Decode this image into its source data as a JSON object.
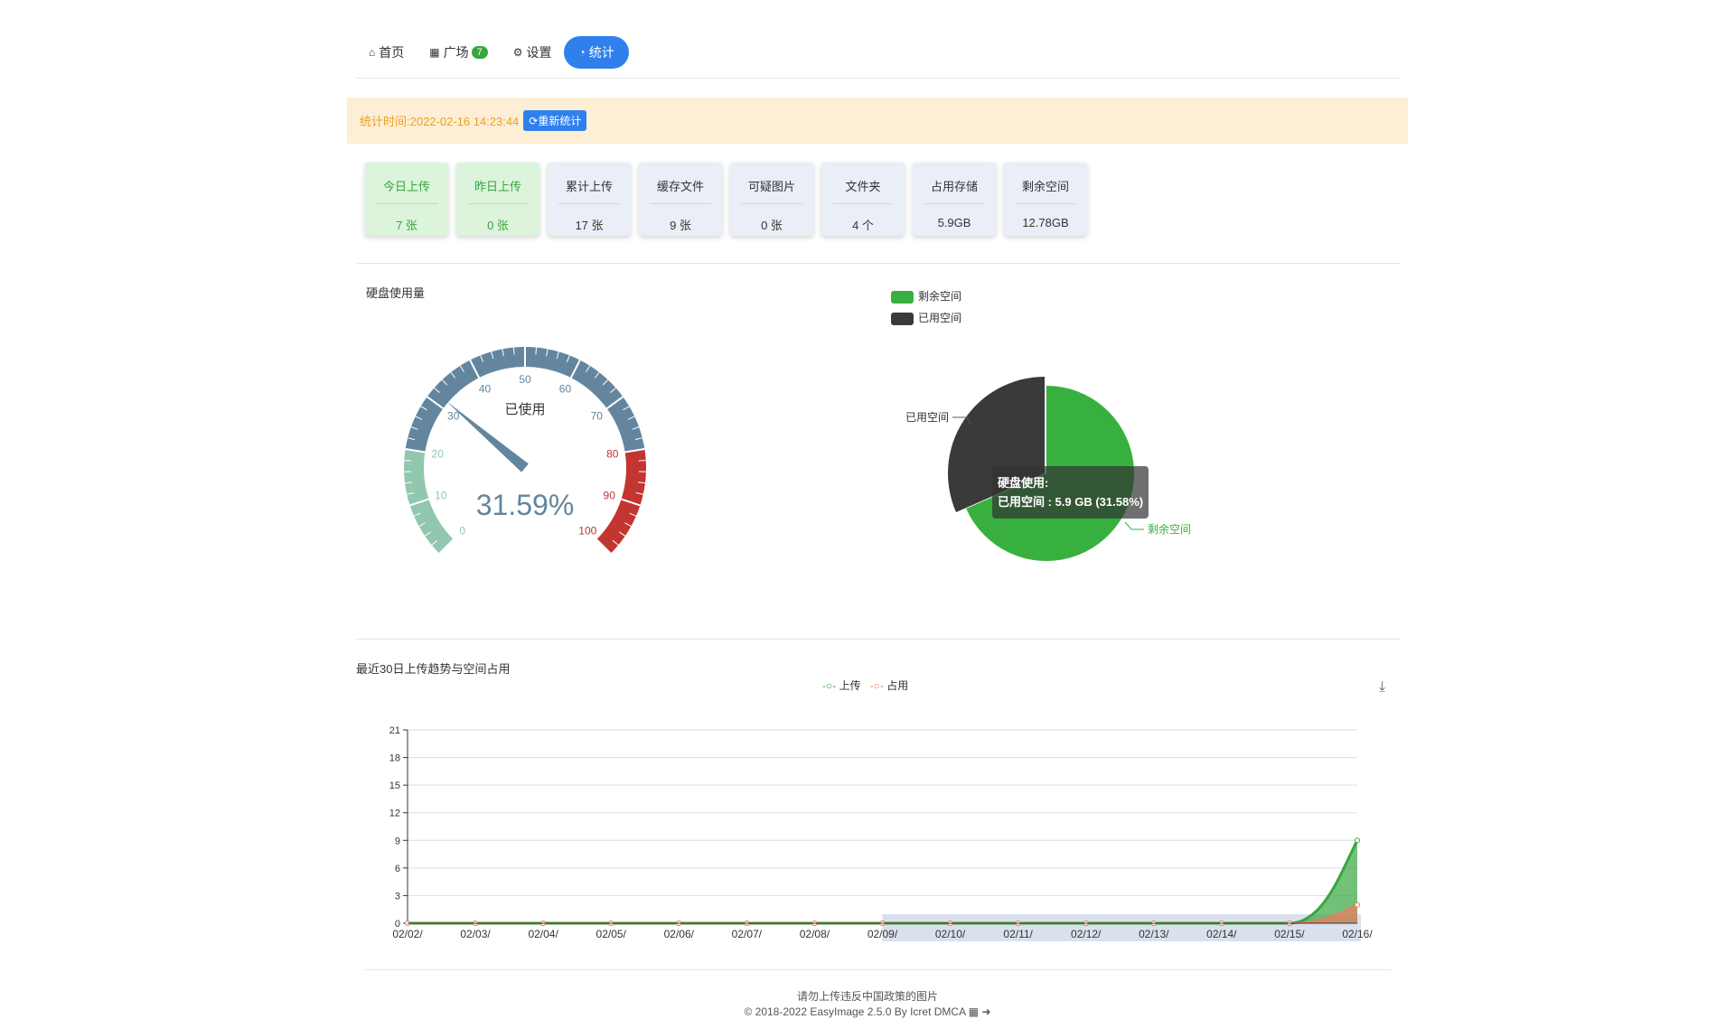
{
  "nav": {
    "items": [
      {
        "label": "首页",
        "icon": "home-icon"
      },
      {
        "label": "广场",
        "icon": "grid-icon",
        "badge": "7"
      },
      {
        "label": "设置",
        "icon": "gears-icon"
      },
      {
        "label": "统计",
        "icon": "pie-chart-icon",
        "active": true
      }
    ]
  },
  "alert": {
    "text": "统计时间:2022-02-16 14:23:44",
    "button": "重新统计",
    "color": "#f0a020"
  },
  "cards": [
    {
      "title": "今日上传",
      "value": "7 张"
    },
    {
      "title": "昨日上传",
      "value": "0 张"
    },
    {
      "title": "累计上传",
      "value": "17 张"
    },
    {
      "title": "缓存文件",
      "value": "9 张"
    },
    {
      "title": "可疑图片",
      "value": "0 张"
    },
    {
      "title": "文件夹",
      "value": "4 个"
    },
    {
      "title": "占用存储",
      "value": "5.9GB"
    },
    {
      "title": "剩余空间",
      "value": "12.78GB"
    }
  ],
  "disk": {
    "title": "硬盘使用量"
  },
  "chart_data": [
    {
      "type": "gauge",
      "title": "已使用",
      "value": 31.59,
      "value_label": "31.59%",
      "min": 0,
      "max": 100,
      "ticks": [
        "0",
        "10",
        "20",
        "30",
        "40",
        "50",
        "60",
        "70",
        "80",
        "90",
        "100"
      ],
      "bands": [
        {
          "to": 20,
          "color": "#91c7ae"
        },
        {
          "to": 80,
          "color": "#63869e"
        },
        {
          "to": 100,
          "color": "#c23531"
        }
      ]
    },
    {
      "type": "pie",
      "legend": [
        "剩余空间",
        "已用空间"
      ],
      "legend_position": "top-left",
      "slices": [
        {
          "name": "剩余空间",
          "value": 12.78,
          "color": "#38b03f"
        },
        {
          "name": "已用空间",
          "value": 5.9,
          "color": "#3a3a3a"
        }
      ],
      "tooltip": {
        "title": "硬盘使用:",
        "line": "已用空间 : 5.9 GB (31.58%)"
      }
    },
    {
      "type": "area",
      "title": "最近30日上传趋势与空间占用",
      "legend_position": "top",
      "categories": [
        "02/02/",
        "02/03/",
        "02/04/",
        "02/05/",
        "02/06/",
        "02/07/",
        "02/08/",
        "02/09/",
        "02/10/",
        "02/11/",
        "02/12/",
        "02/13/",
        "02/14/",
        "02/15/",
        "02/16/"
      ],
      "ylim": [
        0,
        21
      ],
      "yticks": [
        "0",
        "3",
        "6",
        "9",
        "12",
        "15",
        "18",
        "21"
      ],
      "grid": true,
      "series": [
        {
          "name": "上传",
          "color": "#38a63e",
          "values": [
            0,
            0,
            0,
            0,
            0,
            0,
            0,
            0,
            0,
            0,
            0,
            0,
            0,
            0,
            9
          ]
        },
        {
          "name": "占用",
          "color": "#f07a60",
          "values": [
            0,
            0,
            0,
            0,
            0,
            0,
            0,
            0,
            0,
            0,
            0,
            0,
            0,
            0,
            2
          ]
        }
      ]
    }
  ],
  "footer": {
    "line1": "请勿上传违反中国政策的图片",
    "line2": "© 2018-2022 EasyImage 2.5.0 By Icret DMCA"
  }
}
